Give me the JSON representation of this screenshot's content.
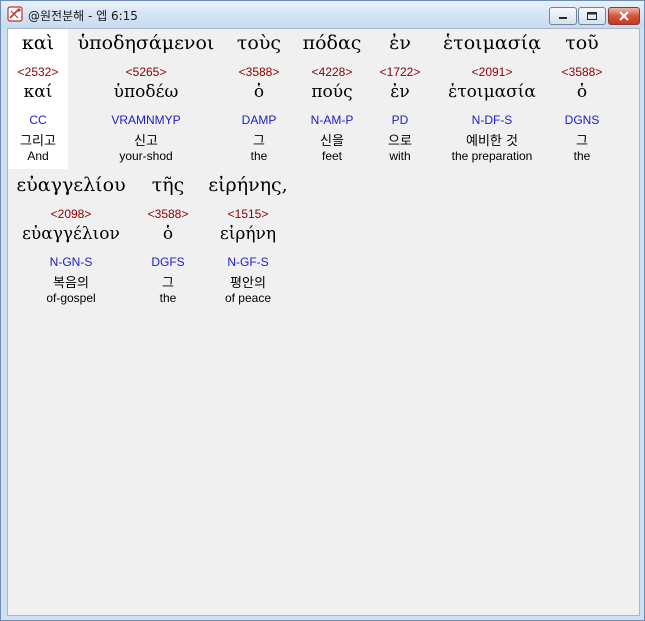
{
  "window": {
    "title": "@원전분해 - 엡 6:15",
    "buttons": {
      "minimize": "minimize",
      "maximize": "maximize",
      "close": "close"
    }
  },
  "words": [
    {
      "greek": "καὶ",
      "strong": "<2532>",
      "lemma": "καί",
      "parse": "CC",
      "korean": "그리고",
      "english": "And"
    },
    {
      "greek": "ὑποδησάμενοι",
      "strong": "<5265>",
      "lemma": "ὑποδέω",
      "parse": "VRAMNMYP",
      "korean": "신고",
      "english": "your-shod"
    },
    {
      "greek": "τοὺς",
      "strong": "<3588>",
      "lemma": "ὁ",
      "parse": "DAMP",
      "korean": "그",
      "english": "the"
    },
    {
      "greek": "πόδας",
      "strong": "<4228>",
      "lemma": "πούς",
      "parse": "N-AM-P",
      "korean": "신을",
      "english": "feet"
    },
    {
      "greek": "ἐν",
      "strong": "<1722>",
      "lemma": "ἐν",
      "parse": "PD",
      "korean": "으로",
      "english": "with"
    },
    {
      "greek": "ἑτοιμασίᾳ",
      "strong": "<2091>",
      "lemma": "ἑτοιμασία",
      "parse": "N-DF-S",
      "korean": "예비한 것",
      "english": "the preparation"
    },
    {
      "greek": "τοῦ",
      "strong": "<3588>",
      "lemma": "ὁ",
      "parse": "DGNS",
      "korean": "그",
      "english": "the"
    },
    {
      "greek": "εὐαγγελίου",
      "strong": "<2098>",
      "lemma": "εὐαγγέλιον",
      "parse": "N-GN-S",
      "korean": "복음의",
      "english": "of-gospel"
    },
    {
      "greek": "τῆς",
      "strong": "<3588>",
      "lemma": "ὁ",
      "parse": "DGFS",
      "korean": "그",
      "english": "the"
    },
    {
      "greek": "εἰρήνης,",
      "strong": "<1515>",
      "lemma": "εἰρήνη",
      "parse": "N-GF-S",
      "korean": "평안의",
      "english": "of peace"
    }
  ]
}
